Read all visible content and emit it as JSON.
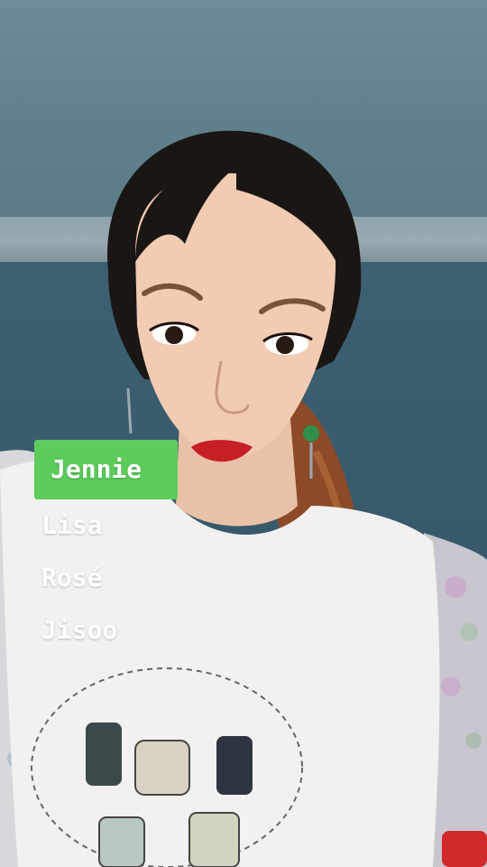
{
  "overlay": {
    "options": [
      {
        "label": "Jennie",
        "selected": true
      },
      {
        "label": "Lisa",
        "selected": false
      },
      {
        "label": "Rosé",
        "selected": false
      },
      {
        "label": "Jisoo",
        "selected": false
      }
    ],
    "selected_color": "#5ccd5a",
    "text_color": "#ffffff"
  },
  "photo": {
    "subject": "woman-with-ponytail",
    "shirt_print": "perfume-bottles"
  }
}
